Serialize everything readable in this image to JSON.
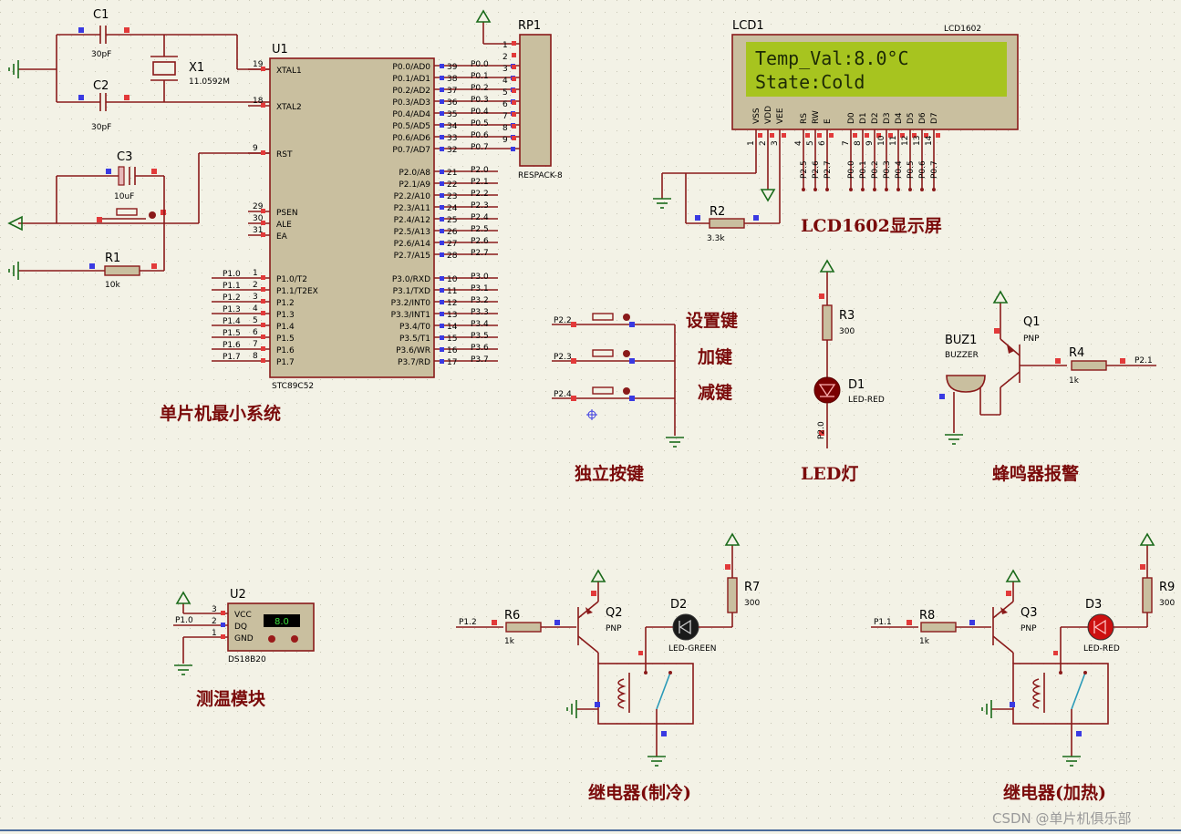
{
  "watermark": "CSDN @单片机俱乐部",
  "section_titles": {
    "mcu": "单片机最小系统",
    "lcd": "LCD1602显示屏",
    "keys": "独立按键",
    "led": "LED灯",
    "buzzer": "蜂鸣器报警",
    "sensor": "测温模块",
    "relay_cool": "继电器(制冷)",
    "relay_heat": "继电器(加热)"
  },
  "key_labels": [
    "设置键",
    "加键",
    "减键"
  ],
  "mcu": {
    "ref": "U1",
    "part": "STC89C52",
    "left_pins": [
      {
        "num": "19",
        "name": "XTAL1"
      },
      {
        "num": "18",
        "name": "XTAL2"
      },
      {
        "num": "9",
        "name": "RST"
      },
      {
        "num": "29",
        "name": "PSEN"
      },
      {
        "num": "30",
        "name": "ALE"
      },
      {
        "num": "31",
        "name": "EA"
      },
      {
        "num": "1",
        "name": "P1.0/T2"
      },
      {
        "num": "2",
        "name": "P1.1/T2EX"
      },
      {
        "num": "3",
        "name": "P1.2"
      },
      {
        "num": "4",
        "name": "P1.3"
      },
      {
        "num": "5",
        "name": "P1.4"
      },
      {
        "num": "6",
        "name": "P1.5"
      },
      {
        "num": "7",
        "name": "P1.6"
      },
      {
        "num": "8",
        "name": "P1.7"
      }
    ],
    "p1_nets": [
      "P1.0",
      "P1.1",
      "P1.2",
      "P1.3",
      "P1.4",
      "P1.5",
      "P1.6",
      "P1.7"
    ],
    "right_p0": [
      {
        "num": "39",
        "name": "P0.0/AD0",
        "net": "P0.0"
      },
      {
        "num": "38",
        "name": "P0.1/AD1",
        "net": "P0.1"
      },
      {
        "num": "37",
        "name": "P0.2/AD2",
        "net": "P0.2"
      },
      {
        "num": "36",
        "name": "P0.3/AD3",
        "net": "P0.3"
      },
      {
        "num": "35",
        "name": "P0.4/AD4",
        "net": "P0.4"
      },
      {
        "num": "34",
        "name": "P0.5/AD5",
        "net": "P0.5"
      },
      {
        "num": "33",
        "name": "P0.6/AD6",
        "net": "P0.6"
      },
      {
        "num": "32",
        "name": "P0.7/AD7",
        "net": "P0.7"
      }
    ],
    "right_p2": [
      {
        "num": "21",
        "name": "P2.0/A8",
        "net": "P2.0"
      },
      {
        "num": "22",
        "name": "P2.1/A9",
        "net": "P2.1"
      },
      {
        "num": "23",
        "name": "P2.2/A10",
        "net": "P2.2"
      },
      {
        "num": "24",
        "name": "P2.3/A11",
        "net": "P2.3"
      },
      {
        "num": "25",
        "name": "P2.4/A12",
        "net": "P2.4"
      },
      {
        "num": "26",
        "name": "P2.5/A13",
        "net": "P2.5"
      },
      {
        "num": "27",
        "name": "P2.6/A14",
        "net": "P2.6"
      },
      {
        "num": "28",
        "name": "P2.7/A15",
        "net": "P2.7"
      }
    ],
    "right_p3": [
      {
        "num": "10",
        "name": "P3.0/RXD",
        "net": "P3.0"
      },
      {
        "num": "11",
        "name": "P3.1/TXD",
        "net": "P3.1"
      },
      {
        "num": "12",
        "name": "P3.2/INT0",
        "net": "P3.2"
      },
      {
        "num": "13",
        "name": "P3.3/INT1",
        "net": "P3.3"
      },
      {
        "num": "14",
        "name": "P3.4/T0",
        "net": "P3.4"
      },
      {
        "num": "15",
        "name": "P3.5/T1",
        "net": "P3.5"
      },
      {
        "num": "16",
        "name": "P3.6/WR",
        "net": "P3.6"
      },
      {
        "num": "17",
        "name": "P3.7/RD",
        "net": "P3.7"
      }
    ]
  },
  "rp1": {
    "ref": "RP1",
    "part": "RESPACK-8",
    "pins": [
      "1",
      "2",
      "3",
      "4",
      "5",
      "6",
      "7",
      "8",
      "9"
    ]
  },
  "c1": {
    "ref": "C1",
    "value": "30pF"
  },
  "c2": {
    "ref": "C2",
    "value": "30pF"
  },
  "c3": {
    "ref": "C3",
    "value": "10uF"
  },
  "x1": {
    "ref": "X1",
    "value": "11.0592M"
  },
  "r1": {
    "ref": "R1",
    "value": "10k"
  },
  "lcd": {
    "ref": "LCD1",
    "part": "LCD1602",
    "line1": "Temp_Val:8.0°C",
    "line2": "State:Cold",
    "pin_names": [
      "VSS",
      "VDD",
      "VEE",
      "RS",
      "RW",
      "E",
      "D0",
      "D1",
      "D2",
      "D3",
      "D4",
      "D5",
      "D6",
      "D7"
    ],
    "pin_nums": [
      "1",
      "2",
      "3",
      "4",
      "5",
      "6",
      "7",
      "8",
      "9",
      "10",
      "11",
      "12",
      "13",
      "14"
    ],
    "nets": [
      "P2.5",
      "P2.6",
      "P2.7",
      "P0.0",
      "P0.1",
      "P0.2",
      "P0.3",
      "P0.4",
      "P0.5",
      "P0.6",
      "P0.7"
    ],
    "lcd_bg": "#a7c41f"
  },
  "r2": {
    "ref": "R2",
    "value": "3.3k"
  },
  "keys": {
    "nets": [
      "P2.2",
      "P2.3",
      "P2.4"
    ]
  },
  "led": {
    "r_ref": "R3",
    "r_value": "300",
    "d_ref": "D1",
    "d_part": "LED-RED",
    "net": "P2.0"
  },
  "buzzer": {
    "ref": "BUZ1",
    "part": "BUZZER",
    "q_ref": "Q1",
    "q_part": "PNP",
    "r_ref": "R4",
    "r_value": "1k",
    "net": "P2.1"
  },
  "sensor": {
    "ref": "U2",
    "part": "DS18B20",
    "pins": [
      {
        "num": "3",
        "name": "VCC"
      },
      {
        "num": "2",
        "name": "DQ"
      },
      {
        "num": "1",
        "name": "GND"
      }
    ],
    "display": "8.0",
    "net": "P1.0"
  },
  "relay_cool": {
    "r_ref": "R6",
    "r_value": "1k",
    "q_ref": "Q2",
    "q_part": "PNP",
    "d_ref": "D2",
    "d_part": "LED-GREEN",
    "r2_ref": "R7",
    "r2_value": "300",
    "net": "P1.2"
  },
  "relay_heat": {
    "r_ref": "R8",
    "r_value": "1k",
    "q_ref": "Q3",
    "q_part": "PNP",
    "d_ref": "D3",
    "d_part": "LED-RED",
    "r2_ref": "R9",
    "r2_value": "300",
    "net": "P1.1"
  }
}
